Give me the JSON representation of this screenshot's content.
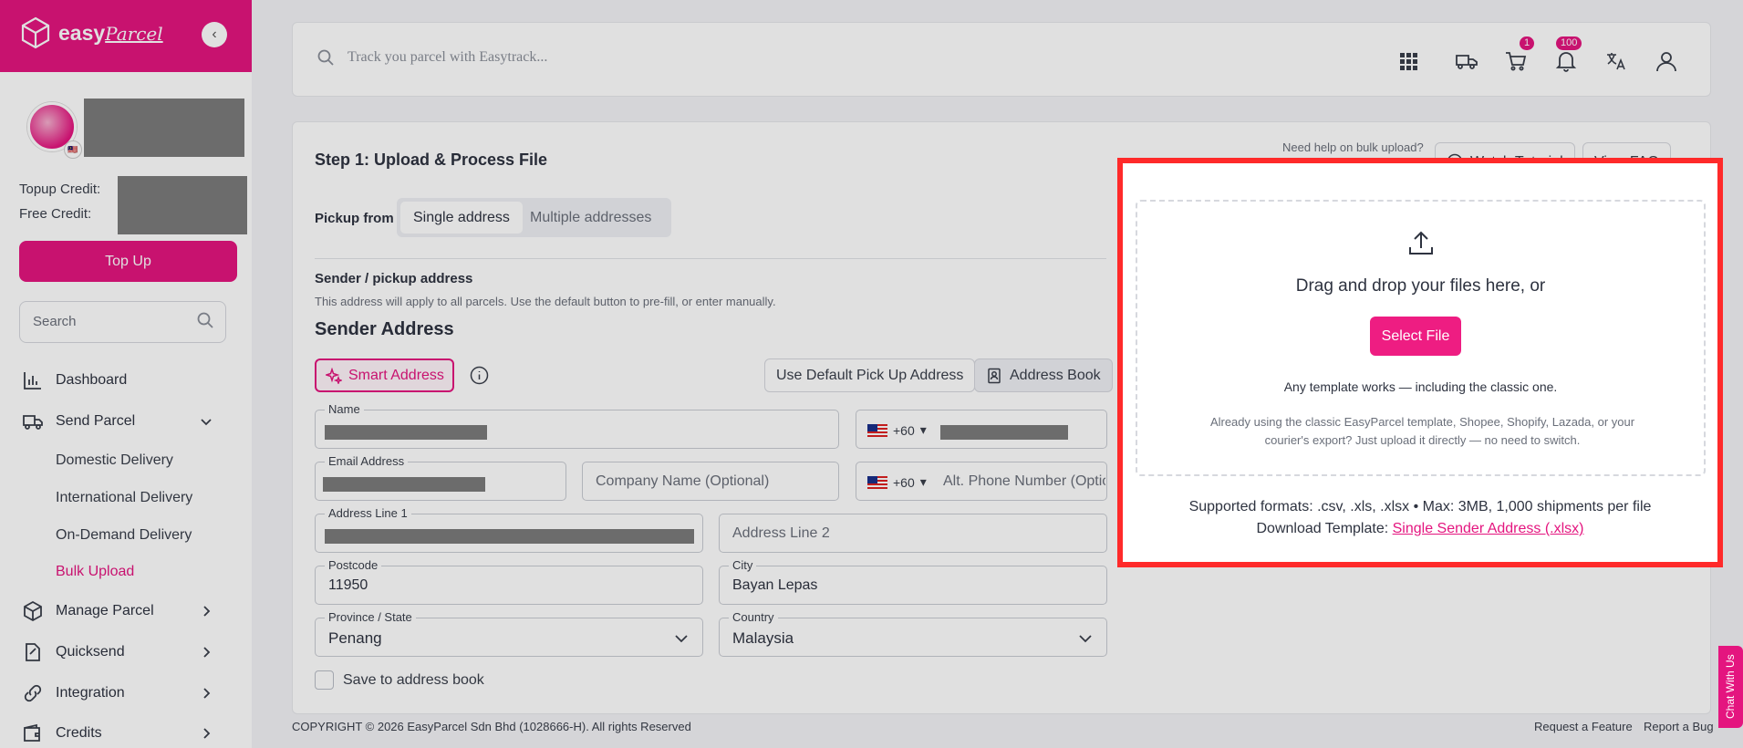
{
  "brand": {
    "name_bold": "easy",
    "name_script": "Parcel"
  },
  "sidebar": {
    "topup_credit_label": "Topup Credit:",
    "free_credit_label": "Free Credit:",
    "topup_button": "Top Up",
    "search_placeholder": "Search",
    "nav": {
      "dashboard": "Dashboard",
      "send_parcel": "Send Parcel",
      "domestic": "Domestic Delivery",
      "international": "International Delivery",
      "on_demand": "On-Demand Delivery",
      "bulk_upload": "Bulk Upload",
      "manage_parcel": "Manage Parcel",
      "quicksend": "Quicksend",
      "integration": "Integration",
      "credits": "Credits"
    }
  },
  "topbar": {
    "search_placeholder": "Track you parcel with Easytrack...",
    "cart_badge": "1",
    "notification_badge": "100"
  },
  "main": {
    "step_title": "Step 1: Upload & Process File",
    "help_text": "Need help on bulk upload?",
    "watch_tutorial": "Watch Tutorial",
    "view_faq": "View FAQ",
    "pickup_label": "Pickup from",
    "pickup_options": [
      "Single address",
      "Multiple addresses"
    ],
    "sender_heading": "Sender / pickup address",
    "sender_desc": "This address will apply to all parcels. Use the default button to pre-fill, or enter manually.",
    "sender_title": "Sender Address",
    "smart_address": "Smart Address",
    "use_default": "Use Default Pick Up Address",
    "address_book": "Address Book",
    "fields": {
      "name_label": "Name",
      "phone_code": "+60",
      "email_label": "Email Address",
      "company_placeholder": "Company Name (Optional)",
      "alt_phone_code": "+60",
      "alt_phone_placeholder": "Alt. Phone Number (Optional)",
      "address1_label": "Address Line 1",
      "address2_placeholder": "Address Line 2",
      "postcode_label": "Postcode",
      "postcode_value": "11950",
      "city_label": "City",
      "city_value": "Bayan Lepas",
      "state_label": "Province / State",
      "state_value": "Penang",
      "country_label": "Country",
      "country_value": "Malaysia"
    },
    "save_to_book": "Save to address book"
  },
  "upload": {
    "drop_text": "Drag and drop your files here, or",
    "select_file": "Select File",
    "template_note": "Any template works — including the classic one.",
    "template_desc": "Already using the classic EasyParcel template, Shopee, Shopify, Lazada, or your courier's export? Just upload it directly — no need to switch.",
    "formats": "Supported formats: .csv, .xls, .xlsx • Max: 3MB, 1,000 shipments per file",
    "download_label": "Download Template:",
    "download_link": "Single Sender Address (.xlsx)"
  },
  "footer": {
    "copyright": "COPYRIGHT © 2026 EasyParcel Sdn Bhd (1028666-H). All rights Reserved",
    "request_feature": "Request a Feature",
    "report_bug": "Report a Bug",
    "chat": "Chat With Us"
  },
  "colors": {
    "brand": "#e4157f",
    "highlight": "#ff2a2a"
  }
}
